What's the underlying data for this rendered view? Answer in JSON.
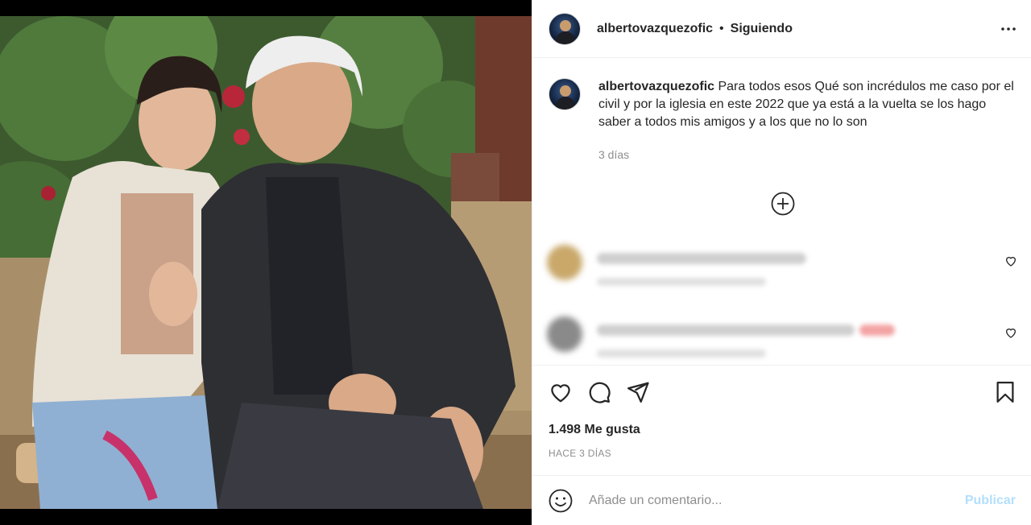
{
  "post": {
    "username": "albertovazquezofic",
    "separator": "•",
    "follow_status": "Siguiendo",
    "caption_text": "Para todos esos Qué son incrédulos me caso por el civil y por la iglesia en este 2022 que ya está a la vuelta se los hago saber a todos mis amigos y a los que no lo son",
    "caption_time": "3 días",
    "likes": "1.498 Me gusta",
    "posted_ago": "HACE 3 DÍAS"
  },
  "composer": {
    "placeholder": "Añade un comentario...",
    "publish_label": "Publicar"
  },
  "icons": {
    "more": "more-horizontal-icon",
    "load_more": "plus-circle-icon",
    "like": "heart-icon",
    "comment": "comment-bubble-icon",
    "share": "paper-plane-icon",
    "save": "bookmark-icon",
    "emoji": "smiley-icon"
  },
  "colors": {
    "text": "#262626",
    "muted": "#8e8e8e",
    "divider": "#efefef",
    "publish_disabled": "#b2dffc"
  }
}
